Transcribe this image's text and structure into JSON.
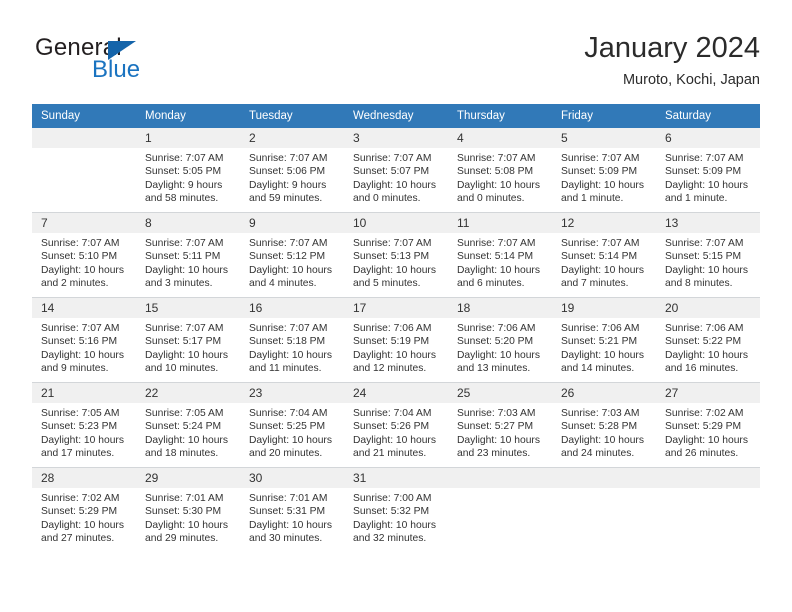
{
  "logo": {
    "word_one": "General",
    "word_two": "Blue",
    "triangle_color": "#1464aa",
    "blue_color": "#1a73c0"
  },
  "header": {
    "title": "January 2024",
    "subtitle": "Muroto, Kochi, Japan"
  },
  "theme": {
    "header_bg": "#3179b8",
    "daynum_bg": "#f0f0f0",
    "grid_line": "#d3d6d9"
  },
  "weekday_headers": [
    "Sunday",
    "Monday",
    "Tuesday",
    "Wednesday",
    "Thursday",
    "Friday",
    "Saturday"
  ],
  "weeks": [
    [
      {
        "day": "",
        "sunrise": "",
        "sunset": "",
        "daylight_1": "",
        "daylight_2": "",
        "empty": true
      },
      {
        "day": "1",
        "sunrise": "Sunrise: 7:07 AM",
        "sunset": "Sunset: 5:05 PM",
        "daylight_1": "Daylight: 9 hours",
        "daylight_2": "and 58 minutes."
      },
      {
        "day": "2",
        "sunrise": "Sunrise: 7:07 AM",
        "sunset": "Sunset: 5:06 PM",
        "daylight_1": "Daylight: 9 hours",
        "daylight_2": "and 59 minutes."
      },
      {
        "day": "3",
        "sunrise": "Sunrise: 7:07 AM",
        "sunset": "Sunset: 5:07 PM",
        "daylight_1": "Daylight: 10 hours",
        "daylight_2": "and 0 minutes."
      },
      {
        "day": "4",
        "sunrise": "Sunrise: 7:07 AM",
        "sunset": "Sunset: 5:08 PM",
        "daylight_1": "Daylight: 10 hours",
        "daylight_2": "and 0 minutes."
      },
      {
        "day": "5",
        "sunrise": "Sunrise: 7:07 AM",
        "sunset": "Sunset: 5:09 PM",
        "daylight_1": "Daylight: 10 hours",
        "daylight_2": "and 1 minute."
      },
      {
        "day": "6",
        "sunrise": "Sunrise: 7:07 AM",
        "sunset": "Sunset: 5:09 PM",
        "daylight_1": "Daylight: 10 hours",
        "daylight_2": "and 1 minute."
      }
    ],
    [
      {
        "day": "7",
        "sunrise": "Sunrise: 7:07 AM",
        "sunset": "Sunset: 5:10 PM",
        "daylight_1": "Daylight: 10 hours",
        "daylight_2": "and 2 minutes."
      },
      {
        "day": "8",
        "sunrise": "Sunrise: 7:07 AM",
        "sunset": "Sunset: 5:11 PM",
        "daylight_1": "Daylight: 10 hours",
        "daylight_2": "and 3 minutes."
      },
      {
        "day": "9",
        "sunrise": "Sunrise: 7:07 AM",
        "sunset": "Sunset: 5:12 PM",
        "daylight_1": "Daylight: 10 hours",
        "daylight_2": "and 4 minutes."
      },
      {
        "day": "10",
        "sunrise": "Sunrise: 7:07 AM",
        "sunset": "Sunset: 5:13 PM",
        "daylight_1": "Daylight: 10 hours",
        "daylight_2": "and 5 minutes."
      },
      {
        "day": "11",
        "sunrise": "Sunrise: 7:07 AM",
        "sunset": "Sunset: 5:14 PM",
        "daylight_1": "Daylight: 10 hours",
        "daylight_2": "and 6 minutes."
      },
      {
        "day": "12",
        "sunrise": "Sunrise: 7:07 AM",
        "sunset": "Sunset: 5:14 PM",
        "daylight_1": "Daylight: 10 hours",
        "daylight_2": "and 7 minutes."
      },
      {
        "day": "13",
        "sunrise": "Sunrise: 7:07 AM",
        "sunset": "Sunset: 5:15 PM",
        "daylight_1": "Daylight: 10 hours",
        "daylight_2": "and 8 minutes."
      }
    ],
    [
      {
        "day": "14",
        "sunrise": "Sunrise: 7:07 AM",
        "sunset": "Sunset: 5:16 PM",
        "daylight_1": "Daylight: 10 hours",
        "daylight_2": "and 9 minutes."
      },
      {
        "day": "15",
        "sunrise": "Sunrise: 7:07 AM",
        "sunset": "Sunset: 5:17 PM",
        "daylight_1": "Daylight: 10 hours",
        "daylight_2": "and 10 minutes."
      },
      {
        "day": "16",
        "sunrise": "Sunrise: 7:07 AM",
        "sunset": "Sunset: 5:18 PM",
        "daylight_1": "Daylight: 10 hours",
        "daylight_2": "and 11 minutes."
      },
      {
        "day": "17",
        "sunrise": "Sunrise: 7:06 AM",
        "sunset": "Sunset: 5:19 PM",
        "daylight_1": "Daylight: 10 hours",
        "daylight_2": "and 12 minutes."
      },
      {
        "day": "18",
        "sunrise": "Sunrise: 7:06 AM",
        "sunset": "Sunset: 5:20 PM",
        "daylight_1": "Daylight: 10 hours",
        "daylight_2": "and 13 minutes."
      },
      {
        "day": "19",
        "sunrise": "Sunrise: 7:06 AM",
        "sunset": "Sunset: 5:21 PM",
        "daylight_1": "Daylight: 10 hours",
        "daylight_2": "and 14 minutes."
      },
      {
        "day": "20",
        "sunrise": "Sunrise: 7:06 AM",
        "sunset": "Sunset: 5:22 PM",
        "daylight_1": "Daylight: 10 hours",
        "daylight_2": "and 16 minutes."
      }
    ],
    [
      {
        "day": "21",
        "sunrise": "Sunrise: 7:05 AM",
        "sunset": "Sunset: 5:23 PM",
        "daylight_1": "Daylight: 10 hours",
        "daylight_2": "and 17 minutes."
      },
      {
        "day": "22",
        "sunrise": "Sunrise: 7:05 AM",
        "sunset": "Sunset: 5:24 PM",
        "daylight_1": "Daylight: 10 hours",
        "daylight_2": "and 18 minutes."
      },
      {
        "day": "23",
        "sunrise": "Sunrise: 7:04 AM",
        "sunset": "Sunset: 5:25 PM",
        "daylight_1": "Daylight: 10 hours",
        "daylight_2": "and 20 minutes."
      },
      {
        "day": "24",
        "sunrise": "Sunrise: 7:04 AM",
        "sunset": "Sunset: 5:26 PM",
        "daylight_1": "Daylight: 10 hours",
        "daylight_2": "and 21 minutes."
      },
      {
        "day": "25",
        "sunrise": "Sunrise: 7:03 AM",
        "sunset": "Sunset: 5:27 PM",
        "daylight_1": "Daylight: 10 hours",
        "daylight_2": "and 23 minutes."
      },
      {
        "day": "26",
        "sunrise": "Sunrise: 7:03 AM",
        "sunset": "Sunset: 5:28 PM",
        "daylight_1": "Daylight: 10 hours",
        "daylight_2": "and 24 minutes."
      },
      {
        "day": "27",
        "sunrise": "Sunrise: 7:02 AM",
        "sunset": "Sunset: 5:29 PM",
        "daylight_1": "Daylight: 10 hours",
        "daylight_2": "and 26 minutes."
      }
    ],
    [
      {
        "day": "28",
        "sunrise": "Sunrise: 7:02 AM",
        "sunset": "Sunset: 5:29 PM",
        "daylight_1": "Daylight: 10 hours",
        "daylight_2": "and 27 minutes."
      },
      {
        "day": "29",
        "sunrise": "Sunrise: 7:01 AM",
        "sunset": "Sunset: 5:30 PM",
        "daylight_1": "Daylight: 10 hours",
        "daylight_2": "and 29 minutes."
      },
      {
        "day": "30",
        "sunrise": "Sunrise: 7:01 AM",
        "sunset": "Sunset: 5:31 PM",
        "daylight_1": "Daylight: 10 hours",
        "daylight_2": "and 30 minutes."
      },
      {
        "day": "31",
        "sunrise": "Sunrise: 7:00 AM",
        "sunset": "Sunset: 5:32 PM",
        "daylight_1": "Daylight: 10 hours",
        "daylight_2": "and 32 minutes."
      },
      {
        "day": "",
        "sunrise": "",
        "sunset": "",
        "daylight_1": "",
        "daylight_2": "",
        "empty": true
      },
      {
        "day": "",
        "sunrise": "",
        "sunset": "",
        "daylight_1": "",
        "daylight_2": "",
        "empty": true
      },
      {
        "day": "",
        "sunrise": "",
        "sunset": "",
        "daylight_1": "",
        "daylight_2": "",
        "empty": true
      }
    ]
  ]
}
